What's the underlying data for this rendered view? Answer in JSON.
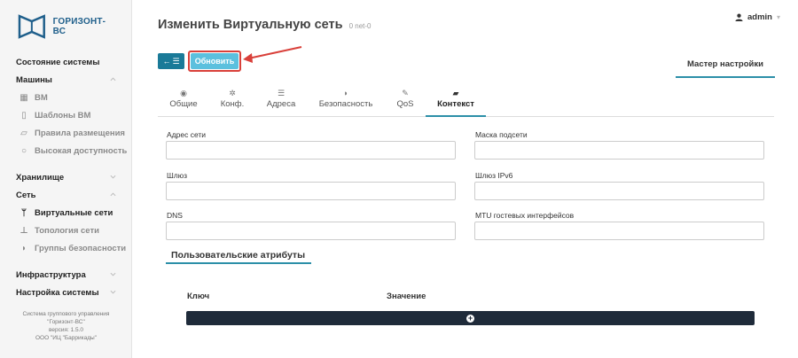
{
  "brand": {
    "name": "ГОРИЗОНТ-ВС"
  },
  "user": {
    "name": "admin"
  },
  "page": {
    "title": "Изменить Виртуальную сеть",
    "subtitle": "0 net-0"
  },
  "toolbar": {
    "update_label": "Обновить",
    "wizard_label": "Мастер настройки"
  },
  "sidebar": {
    "status": "Состояние системы",
    "machines": "Машины",
    "vm": "ВМ",
    "vm_templates": "Шаблоны ВМ",
    "placement_rules": "Правила размещения",
    "high_availability": "Высокая доступность",
    "storage": "Хранилище",
    "network": "Сеть",
    "virtual_networks": "Виртуальные сети",
    "network_topology": "Топология сети",
    "security_groups": "Группы безопасности",
    "infrastructure": "Инфраструктура",
    "system_settings": "Настройка системы"
  },
  "footer": {
    "line1": "Система группового управления",
    "line2": "\"Горизонт-ВС\"",
    "line3": "версия: 1.5.0",
    "line4": "ООО \"ИЦ \"Баррикады\""
  },
  "tabs": {
    "general": "Общие",
    "conf": "Конф.",
    "addresses": "Адреса",
    "security": "Безопасность",
    "qos": "QoS",
    "context": "Контекст"
  },
  "form": {
    "network_address": {
      "label": "Адрес сети",
      "value": ""
    },
    "netmask": {
      "label": "Маска подсети",
      "value": ""
    },
    "gateway": {
      "label": "Шлюз",
      "value": ""
    },
    "gateway_ipv6": {
      "label": "Шлюз IPv6",
      "value": ""
    },
    "dns": {
      "label": "DNS",
      "value": ""
    },
    "guest_mtu": {
      "label": "MTU гостевых интерфейсов",
      "value": ""
    }
  },
  "custom_attrs": {
    "title": "Пользовательские атрибуты",
    "col_key": "Ключ",
    "col_value": "Значение"
  },
  "colors": {
    "accent": "#2c8fa8",
    "primary_btn": "#1a7a98",
    "info_btn": "#5bc0de",
    "highlight": "#d9403a",
    "dark_bar": "#1f2b3a"
  }
}
